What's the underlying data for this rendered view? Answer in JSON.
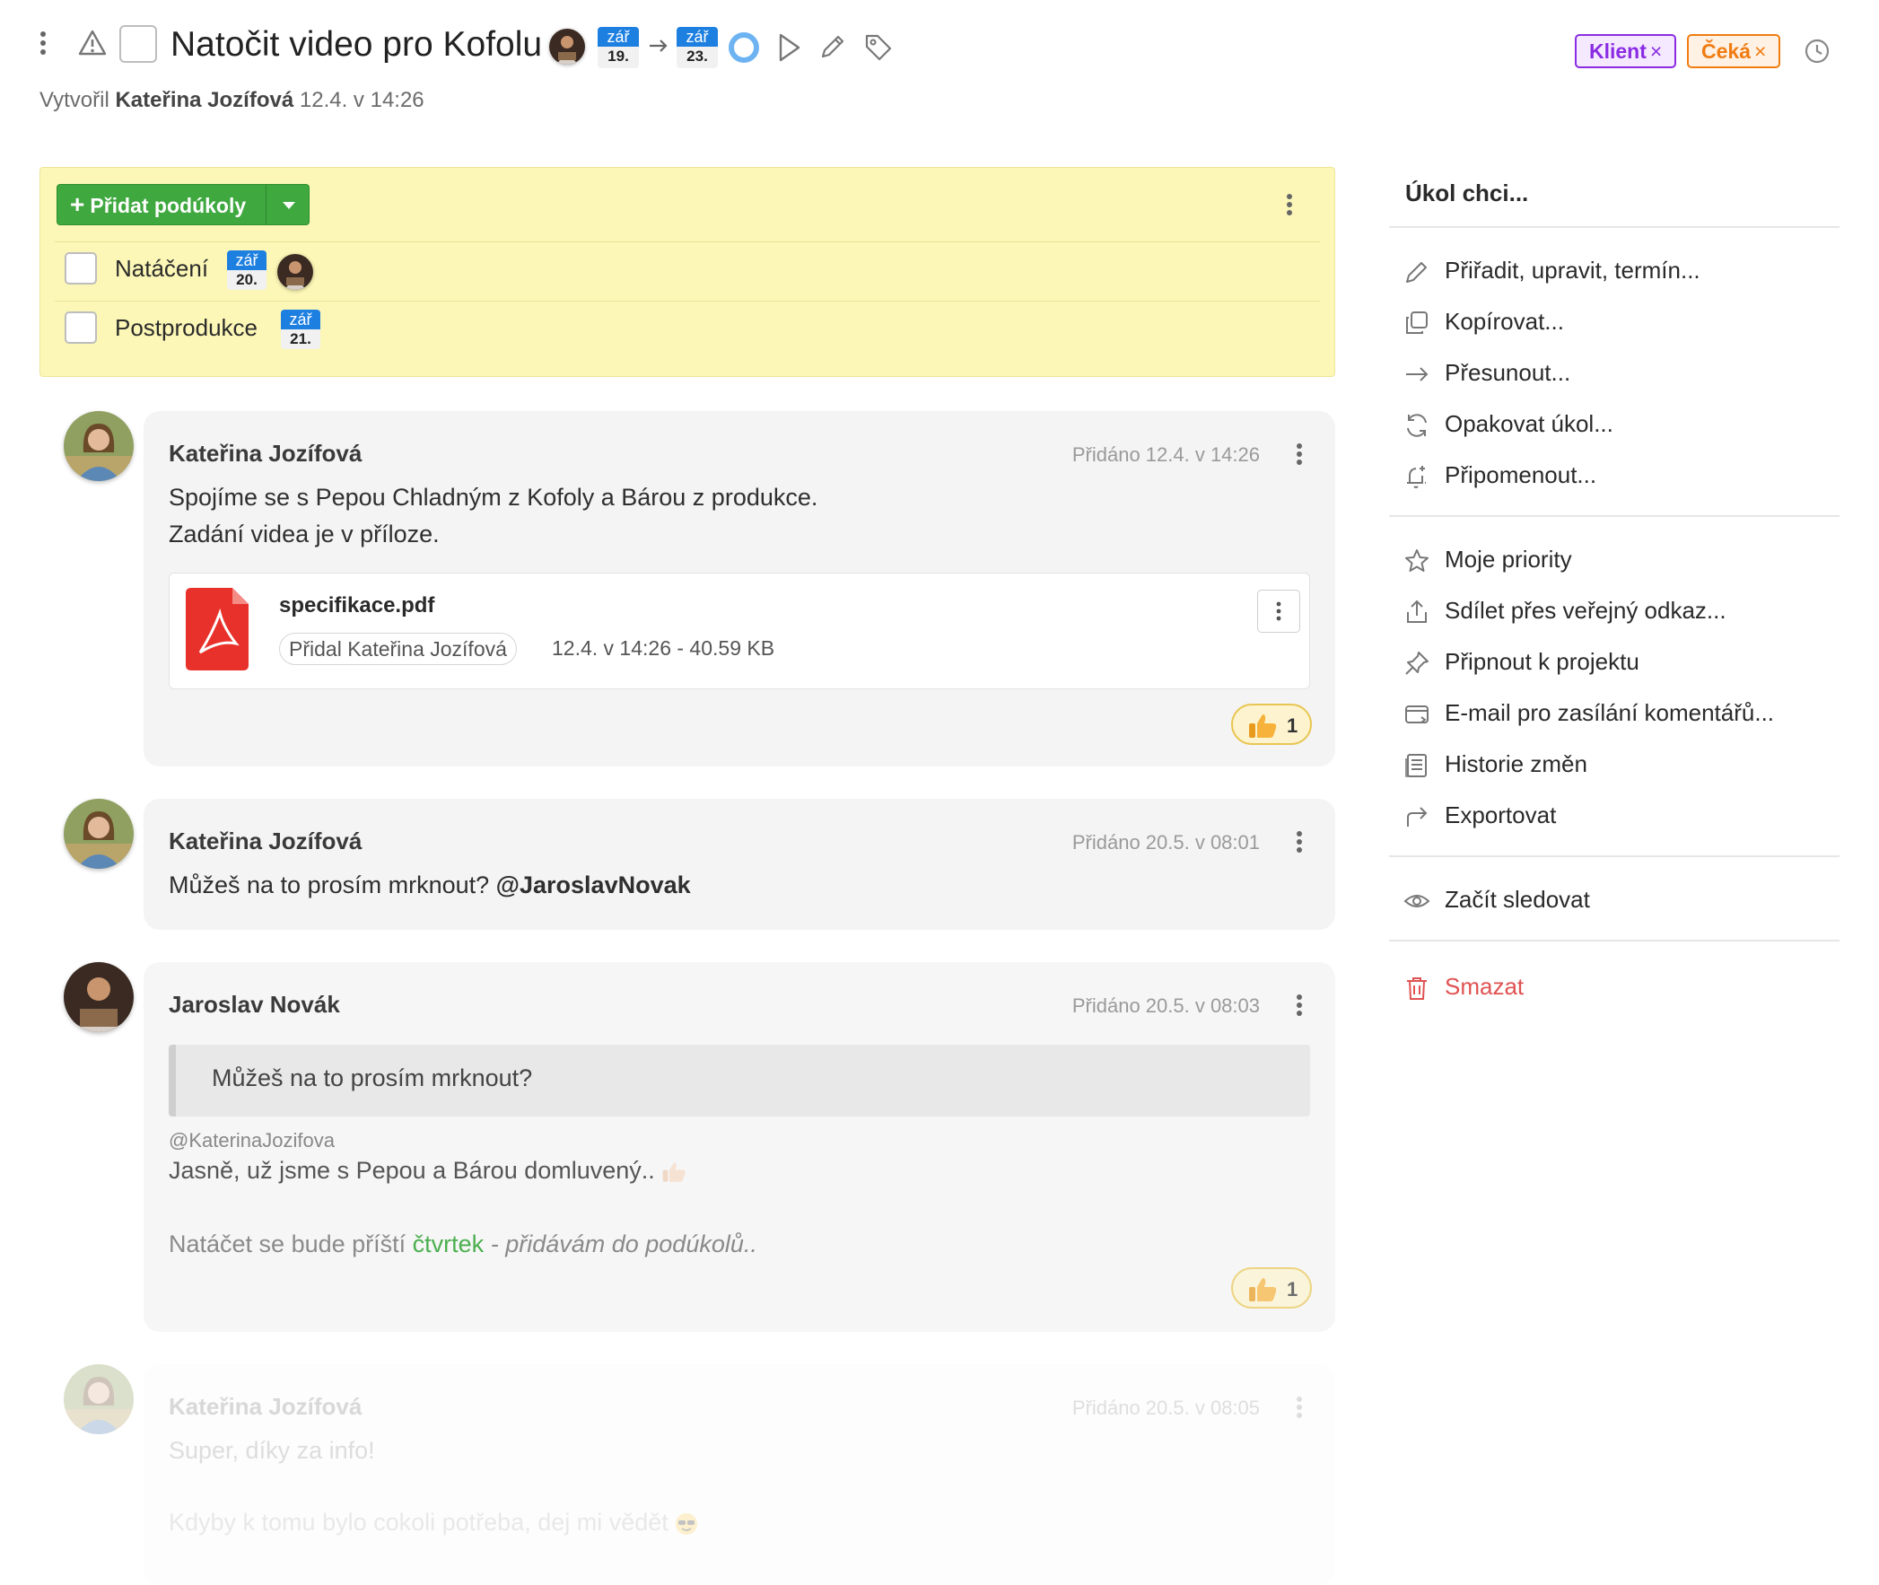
{
  "task": {
    "title": "Natočit video pro Kofolu",
    "created_prefix": "Vytvořil",
    "created_by": "Kateřina Jozífová",
    "created_at": "12.4. v 14:26",
    "start_date": {
      "month": "zář",
      "day": "19."
    },
    "end_date": {
      "month": "zář",
      "day": "23."
    },
    "tags": [
      {
        "label": "Klient",
        "color": "#8a2be2",
        "bg": "#f4e9ff"
      },
      {
        "label": "Čeká",
        "color": "#f07c12",
        "bg": "#fff1e3"
      }
    ],
    "icons": [
      "more-vertical-icon",
      "warning-icon",
      "progress-ring-icon",
      "play-icon",
      "pencil-icon",
      "tag-icon",
      "clock-icon"
    ]
  },
  "subtasks": {
    "add_label": "Přidat podúkoly",
    "items": [
      {
        "label": "Natáčení",
        "month": "zář",
        "day": "20."
      },
      {
        "label": "Postprodukce",
        "month": "zář",
        "day": "21."
      }
    ]
  },
  "comments": [
    {
      "author": "Kateřina Jozífová",
      "date": "Přidáno 12.4. v 14:26",
      "lines": [
        "Spojíme se s Pepou Chladným z Kofoly a Bárou z produkce.",
        "Zadání videa je v příloze."
      ],
      "attachment": {
        "filename": "specifikace.pdf",
        "added_by": "Přidal Kateřina Jozífová",
        "info": "12.4. v 14:26 - 40.59 KB"
      },
      "reaction": "1"
    },
    {
      "author": "Kateřina Jozífová",
      "date": "Přidáno 20.5. v 08:01",
      "text": "Můžeš na to prosím mrknout?",
      "mention": "@JaroslavNovak"
    },
    {
      "author": "Jaroslav Novák",
      "date": "Přidáno 20.5. v 08:03",
      "quote": "Můžeš na to prosím mrknout?",
      "quote_author": "@KaterinaJozifova",
      "reply": "Jasně, už jsme s Pepou a Bárou domluvený..",
      "line2_prefix": "Natáčet se bude příští",
      "line2_link": "čtvrtek",
      "line2_suffix": "- přidávám do podúkolů..",
      "reaction": "1"
    },
    {
      "author": "Kateřina Jozífová",
      "date": "Přidáno 20.5. v 08:05",
      "line1": "Super, díky za info!",
      "line2": "Kdyby k tomu bylo cokoli potřeba, dej mi vědět"
    }
  ],
  "menu": {
    "title": "Úkol chci...",
    "groups": [
      [
        {
          "label": "Přiřadit, upravit, termín...",
          "icon": "pencil-icon"
        },
        {
          "label": "Kopírovat...",
          "icon": "copy-icon"
        },
        {
          "label": "Přesunout...",
          "icon": "arrow-right-icon"
        },
        {
          "label": "Opakovat úkol...",
          "icon": "repeat-icon"
        },
        {
          "label": "Připomenout...",
          "icon": "bell-icon"
        }
      ],
      [
        {
          "label": "Moje priority",
          "icon": "star-icon"
        },
        {
          "label": "Sdílet přes veřejný odkaz...",
          "icon": "share-icon"
        },
        {
          "label": "Připnout k projektu",
          "icon": "pin-icon"
        },
        {
          "label": "E-mail pro zasílání komentářů...",
          "icon": "email-icon"
        },
        {
          "label": "Historie změn",
          "icon": "history-icon"
        },
        {
          "label": "Exportovat",
          "icon": "export-icon"
        }
      ],
      [
        {
          "label": "Začít sledovat",
          "icon": "eye-icon"
        }
      ],
      [
        {
          "label": "Smazat",
          "icon": "trash-icon",
          "color": "#e05252"
        }
      ]
    ]
  }
}
